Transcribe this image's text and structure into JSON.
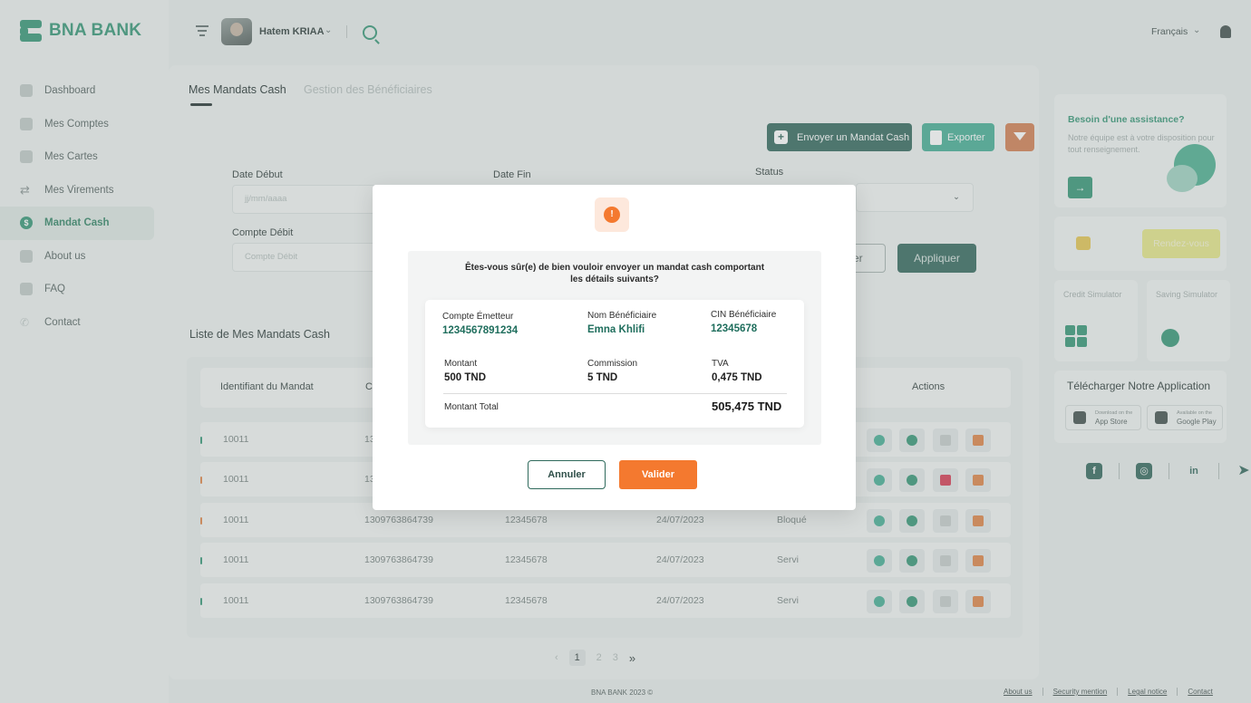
{
  "brand": {
    "name": "BNA BANK",
    "color": "#3e9b7c"
  },
  "header": {
    "user_name": "Hatem KRIAA",
    "language": "Français"
  },
  "sidebar": {
    "items": [
      {
        "label": "Dashboard",
        "icon": "dashboard-icon"
      },
      {
        "label": "Mes Comptes",
        "icon": "accounts-icon"
      },
      {
        "label": "Mes Cartes",
        "icon": "cards-icon"
      },
      {
        "label": "Mes Virements",
        "icon": "transfer-icon"
      },
      {
        "label": "Mandat Cash",
        "icon": "cash-icon",
        "active": true
      },
      {
        "label": "About us",
        "icon": "info-icon"
      },
      {
        "label": "FAQ",
        "icon": "faq-icon"
      },
      {
        "label": "Contact",
        "icon": "phone-icon"
      }
    ]
  },
  "tabs": {
    "active": "Mes Mandats Cash",
    "inactive": "Gestion des Bénéficiaires"
  },
  "toolbar": {
    "send_label": "Envoyer un Mandat Cash",
    "export_label": "Exporter"
  },
  "filters": {
    "date_debut_label": "Date Début",
    "date_debut_placeholder": "jj/mm/aaaa",
    "date_fin_label": "Date  Fin",
    "status_label": "Status",
    "compte_label": "Compte Débit",
    "compte_placeholder": "Compte Débit",
    "reset_partial": "er",
    "apply_label": "Appliquer"
  },
  "list": {
    "title": "Liste de Mes Mandats Cash",
    "headers": {
      "id": "Identifiant du Mandat",
      "c_partial": "C",
      "actions": "Actions"
    },
    "rows": [
      {
        "id": "10011",
        "c1": "13",
        "c2": "",
        "c3": "",
        "status": "",
        "tick": "#3e9b7c",
        "lock": "#c9cfce"
      },
      {
        "id": "10011",
        "c1": "13",
        "c2": "",
        "c3": "",
        "status": "",
        "tick": "#e08a4f",
        "lock": "#d9455b"
      },
      {
        "id": "10011",
        "c1": "1309763864739",
        "c2": "12345678",
        "c3": "24/07/2023",
        "status": "Bloqué",
        "tick": "#e08a4f",
        "lock": "#c9cfce"
      },
      {
        "id": "10011",
        "c1": "1309763864739",
        "c2": "12345678",
        "c3": "24/07/2023",
        "status": "Servi",
        "tick": "#3e9b7c",
        "lock": "#c9cfce"
      },
      {
        "id": "10011",
        "c1": "1309763864739",
        "c2": "12345678",
        "c3": "24/07/2023",
        "status": "Servi",
        "tick": "#3e9b7c",
        "lock": "#c9cfce"
      }
    ]
  },
  "pagination": {
    "pages": [
      "1",
      "2",
      "3"
    ],
    "next": "»"
  },
  "assistance": {
    "title": "Besoin d'une assistance?",
    "text": "Notre équipe est à votre disposition pour tout renseignement.",
    "rdv_label": "Rendez-vous"
  },
  "simulators": {
    "credit": "Credit Simulator",
    "saving": "Saving Simulator"
  },
  "download": {
    "title": "Télécharger Notre Application",
    "appstore_small": "Download on the",
    "appstore": "App Store",
    "play_small": "Available on the",
    "play": "Google Play"
  },
  "social": [
    "facebook-icon",
    "instagram-icon",
    "linkedin-icon",
    "twitter-icon"
  ],
  "footer": {
    "copyright": "BNA BANK 2023 ©",
    "links": [
      "About us",
      "Security mention",
      "Legal notice",
      "Contact"
    ]
  },
  "modal": {
    "question_line1": "Êtes-vous sûr(e) de bien vouloir envoyer un mandat cash comportant",
    "question_line2": "les détails suivants?",
    "compte_emetteur_label": "Compte Émetteur",
    "compte_emetteur_value": "1234567891234",
    "nom_beneficiaire_label": "Nom Bénéficiaire",
    "nom_beneficiaire_value": "Emna Khlifi",
    "cin_label": "CIN Bénéficiaire",
    "cin_value": "12345678",
    "montant_label": "Montant",
    "montant_value": "500 TND",
    "commission_label": "Commission",
    "commission_value": "5 TND",
    "tva_label": "TVA",
    "tva_value": "0,475 TND",
    "total_label": "Montant Total",
    "total_value": "505,475 TND",
    "cancel_label": "Annuler",
    "validate_label": "Valider",
    "accent": "#f4792f"
  }
}
